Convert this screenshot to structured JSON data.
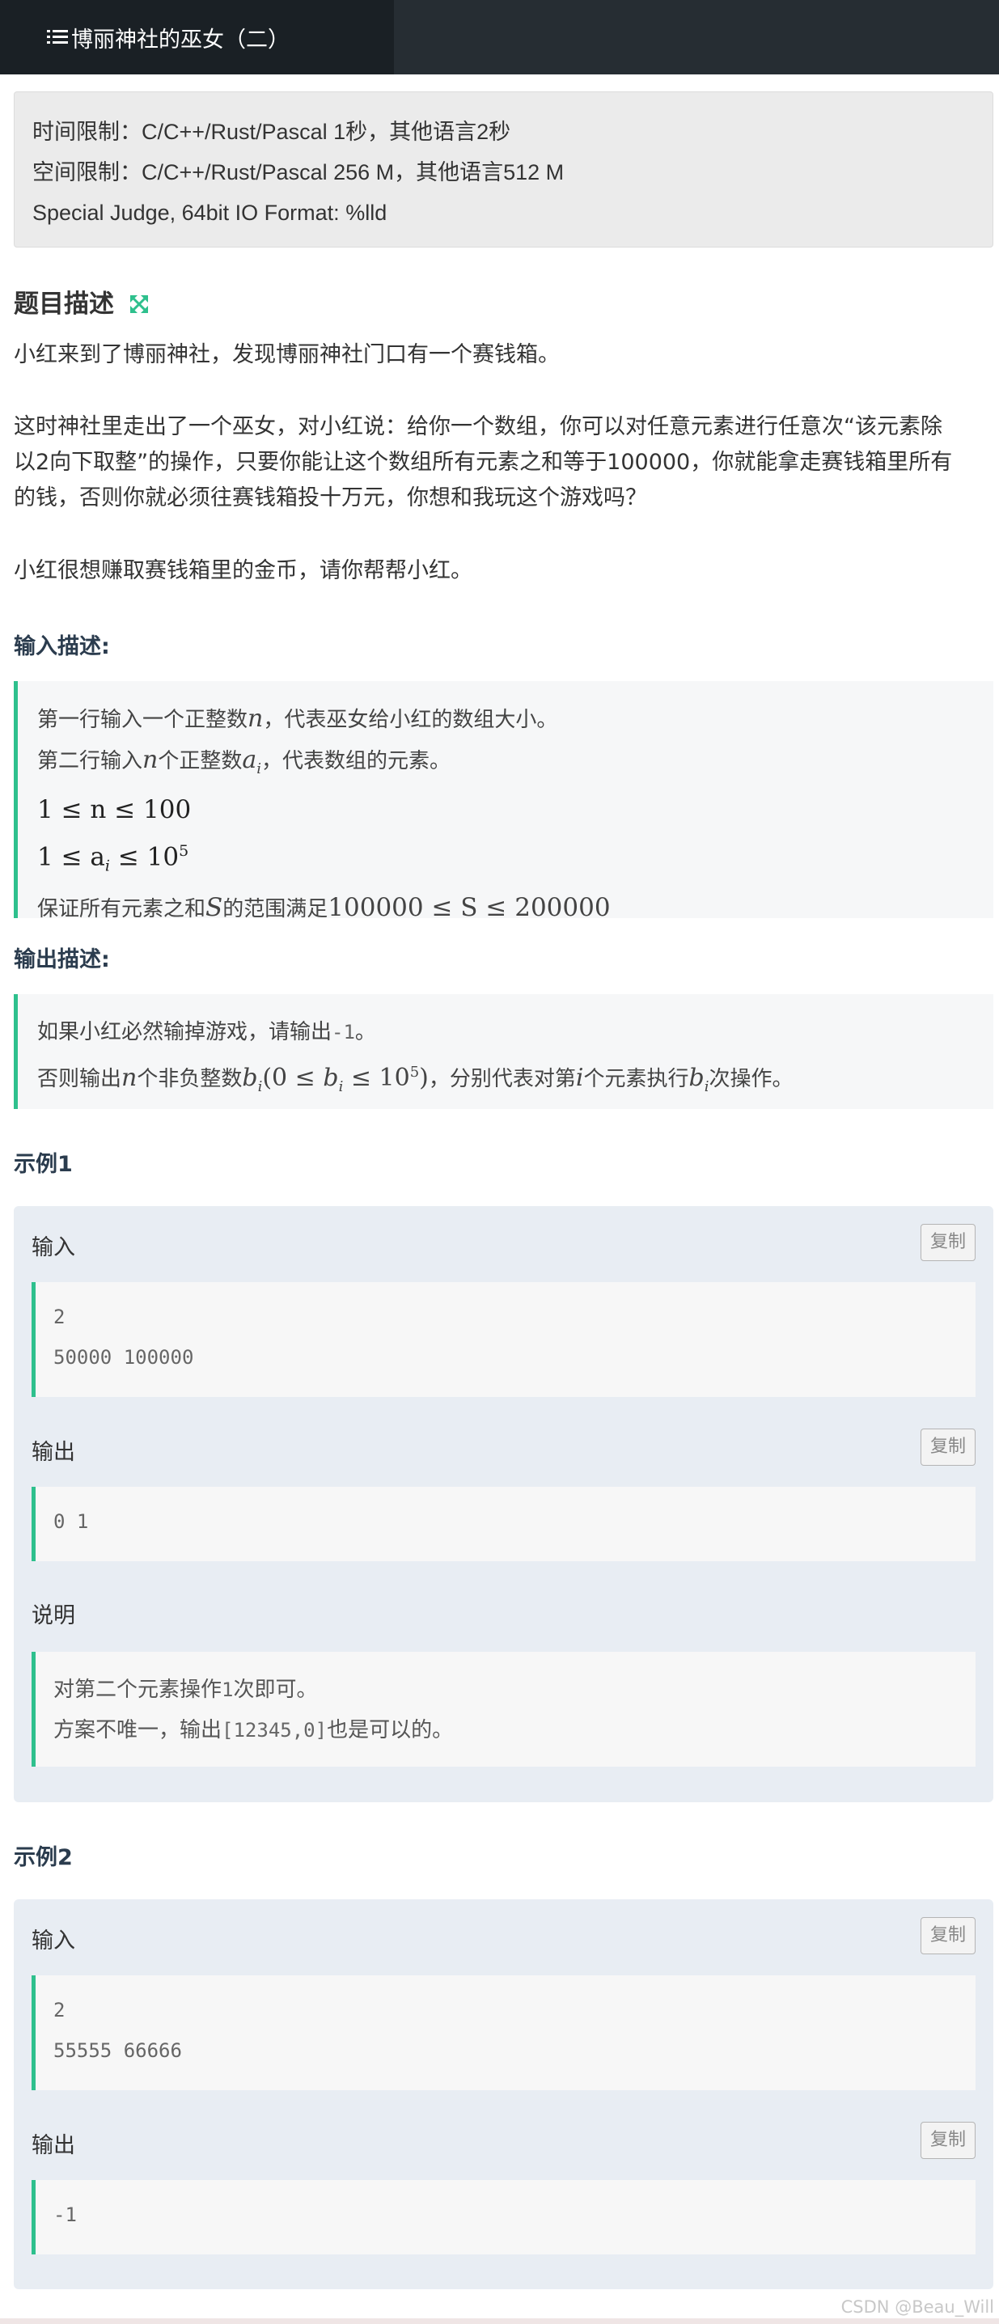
{
  "header": {
    "title": "博丽神社的巫女（二）"
  },
  "limits": {
    "time": "时间限制：C/C++/Rust/Pascal 1秒，其他语言2秒",
    "space": "空间限制：C/C++/Rust/Pascal 256 M，其他语言512 M",
    "judge": "Special Judge, 64bit IO Format: %lld"
  },
  "description": {
    "title": "题目描述",
    "p1": "小红来到了博丽神社，发现博丽神社门口有一个赛钱箱。",
    "p2a": "这时神社里走出了一个巫女，对小红说：给你一个数组，你可以对任意元素进行任意次“该元素除",
    "p2b": "以2向下取整”的操作，只要你能让这个数组所有元素之和等于100000，你就能拿走赛钱箱里所有",
    "p2c": "的钱，否则你就必须往赛钱箱投十万元，你想和我玩这个游戏吗？",
    "p3": "小红很想赚取赛钱箱里的金币，请你帮帮小红。"
  },
  "input": {
    "title": "输入描述:",
    "l1a": "第一行输入一个正整数",
    "l1b": "，代表巫女给小红的数组大小。",
    "l2a": "第二行输入",
    "l2b": "个正整数",
    "l2c": "，代表数组的元素。",
    "c1": "1 ≤ n ≤ 100",
    "c2": "1 ≤ a",
    "c2b": " ≤ 10",
    "l5a": "保证所有元素之和",
    "l5b": "的范围满足",
    "l5c": "100000 ≤ S ≤ 200000"
  },
  "output": {
    "title": "输出描述:",
    "l1a": "如果小红必然输掉游戏，请输出",
    "l1code": "-1",
    "l1b": "。",
    "l2a": "否则输出",
    "l2b": "个非负整数",
    "l2c": "，分别代表对第",
    "l2d": "个元素执行",
    "l2e": "次操作。"
  },
  "example1": {
    "title": "示例1",
    "input_label": "输入",
    "copy_label": "复制",
    "input_lines": [
      "2",
      "50000 100000"
    ],
    "output_label": "输出",
    "output_lines": [
      "0 1"
    ],
    "explain_label": "说明",
    "explain_l1a": "对第二个元素操作",
    "explain_l1code": "1",
    "explain_l1b": "次即可。",
    "explain_l2a": "方案不唯一，输出",
    "explain_l2code": "[12345,0]",
    "explain_l2b": "也是可以的。"
  },
  "example2": {
    "title": "示例2",
    "input_label": "输入",
    "copy_label": "复制",
    "input_lines": [
      "2",
      "55555 66666"
    ],
    "output_label": "输出",
    "output_lines": [
      "-1"
    ]
  },
  "watermark": "CSDN @Beau_Will",
  "colors": {
    "accent": "#2ec08d",
    "topbar": "#262d33",
    "example_bg": "#e8edf3"
  }
}
